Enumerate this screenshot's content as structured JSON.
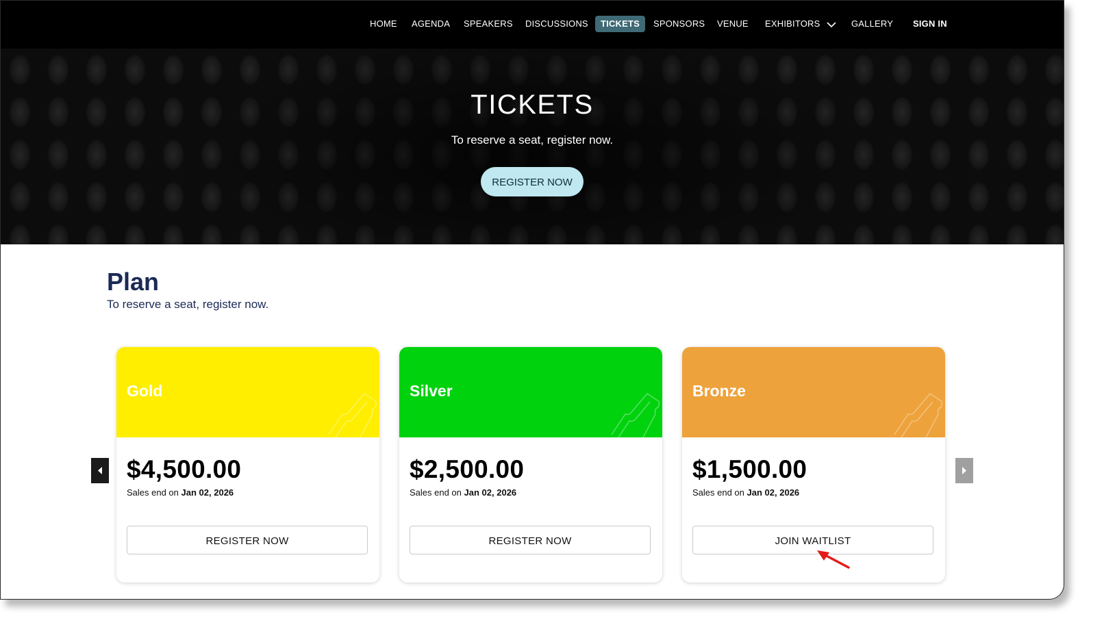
{
  "nav": {
    "items": [
      {
        "label": "HOME"
      },
      {
        "label": "AGENDA"
      },
      {
        "label": "SPEAKERS"
      },
      {
        "label": "DISCUSSIONS"
      },
      {
        "label": "TICKETS"
      },
      {
        "label": "SPONSORS"
      },
      {
        "label": "VENUE"
      },
      {
        "label": "EXHIBITORS"
      },
      {
        "label": "GALLERY"
      }
    ],
    "active": "TICKETS",
    "signin_label": "SIGN IN"
  },
  "hero": {
    "title": "TICKETS",
    "subtitle": "To reserve a seat, register now.",
    "button_label": "REGISTER NOW",
    "button_color": "#bfe8f0"
  },
  "plan": {
    "title": "Plan",
    "subtitle": "To reserve a seat, register now.",
    "title_color": "#1b2a55"
  },
  "cards": [
    {
      "name": "Gold",
      "color": "#ffee00",
      "price": "$4,500.00",
      "sales_prefix": "Sales end on",
      "sales_date": "Jan 02, 2026",
      "button_label": "REGISTER NOW"
    },
    {
      "name": "Silver",
      "color": "#00d20e",
      "price": "$2,500.00",
      "sales_prefix": "Sales end on",
      "sales_date": "Jan 02, 2026",
      "button_label": "REGISTER NOW"
    },
    {
      "name": "Bronze",
      "color": "#eea23c",
      "price": "$1,500.00",
      "sales_prefix": "Sales end on",
      "sales_date": "Jan 02, 2026",
      "button_label": "JOIN WAITLIST"
    }
  ],
  "icons": {
    "prev": "caret-left-icon",
    "next": "caret-right-icon",
    "dropdown": "chevron-down-icon",
    "ticket": "ticket-icon",
    "annotation": "red-arrow-icon"
  }
}
